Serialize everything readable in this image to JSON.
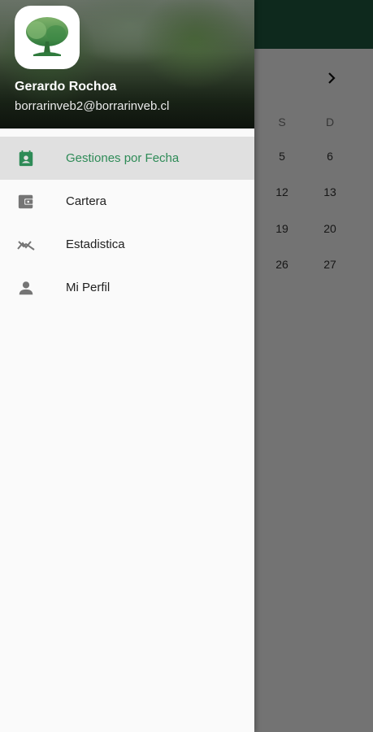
{
  "header": {
    "user_name": "Gerardo Rochoa",
    "user_email": "borrarinveb2@borrarinveb.cl"
  },
  "menu": {
    "items": [
      {
        "label": "Gestiones por Fecha",
        "icon": "calendar-contact-icon",
        "active": true
      },
      {
        "label": "Cartera",
        "icon": "wallet-icon",
        "active": false
      },
      {
        "label": "Estadistica",
        "icon": "trending-icon",
        "active": false
      },
      {
        "label": "Mi Perfil",
        "icon": "person-icon",
        "active": false
      }
    ]
  },
  "background_calendar": {
    "day_headers": [
      "S",
      "D"
    ],
    "rows": [
      [
        "5",
        "6"
      ],
      [
        "12",
        "13"
      ],
      [
        "19",
        "20"
      ],
      [
        "26",
        "27"
      ]
    ]
  },
  "colors": {
    "accent": "#2e8b57",
    "app_bar": "#1f5a3f",
    "active_item_bg": "#e0e0e0"
  }
}
